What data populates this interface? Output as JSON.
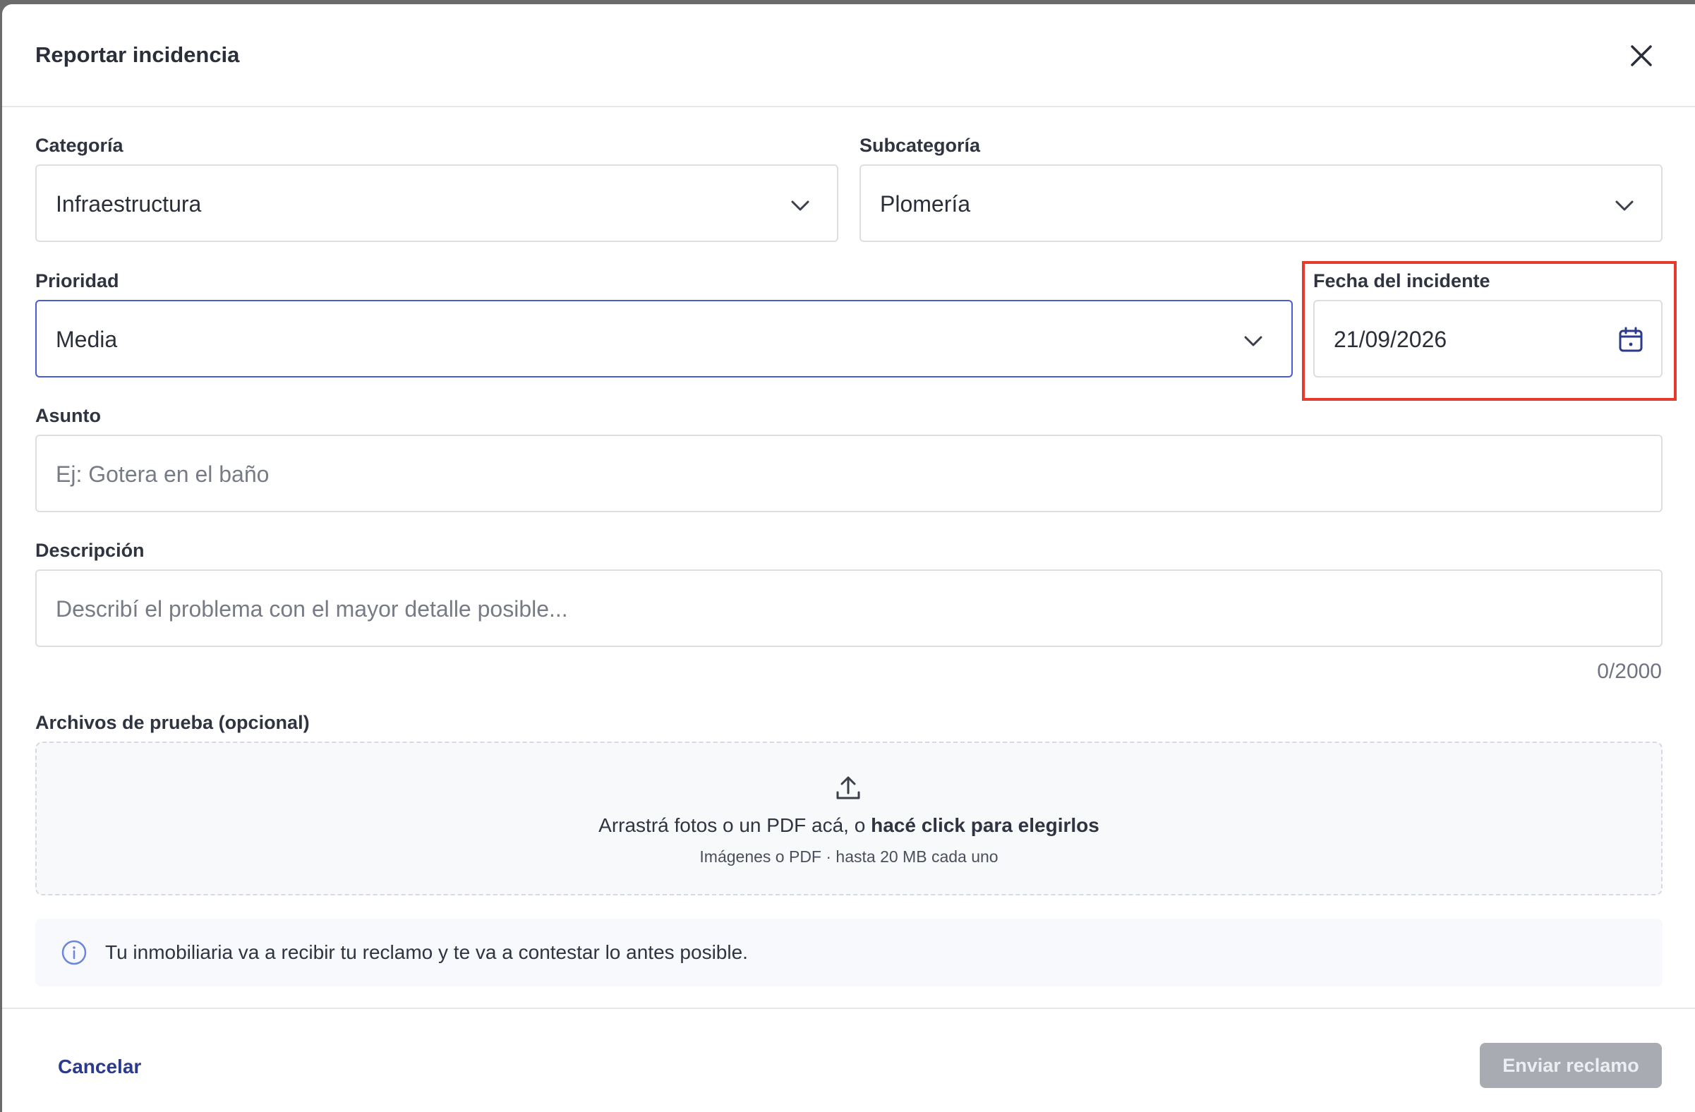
{
  "modal": {
    "title": "Reportar incidencia"
  },
  "form": {
    "categoria": {
      "label": "Categoría",
      "value": "Infraestructura"
    },
    "subcategoria": {
      "label": "Subcategoría",
      "value": "Plomería"
    },
    "prioridad": {
      "label": "Prioridad",
      "value": "Media"
    },
    "fecha": {
      "label": "Fecha del incidente",
      "value": "21/09/2026"
    },
    "asunto": {
      "label": "Asunto",
      "placeholder": "Ej: Gotera en el baño"
    },
    "descripcion": {
      "label": "Descripción",
      "placeholder": "Describí el problema con el mayor detalle posible...",
      "counter": "0/2000"
    },
    "archivos": {
      "label": "Archivos de prueba (opcional)",
      "drop_text": "Arrastrá fotos o un PDF acá, o ",
      "drop_link": "hacé click para elegirlos",
      "drop_hint": "Imágenes o PDF · hasta 20 MB cada uno"
    },
    "info": "Tu inmobiliaria va a recibir tu reclamo y te va a contestar lo antes posible."
  },
  "footer": {
    "cancel_label": "Cancelar",
    "submit_label": "Enviar reclamo"
  },
  "icons": {
    "close": "close-icon",
    "chevron": "chevron-down-icon",
    "calendar": "calendar-icon",
    "upload": "upload-icon",
    "info": "info-icon"
  },
  "colors": {
    "focus_border": "#4a5bd6",
    "highlight": "#e53a2d",
    "link": "#2b3a8a",
    "submit_disabled": "#a9abb3"
  }
}
